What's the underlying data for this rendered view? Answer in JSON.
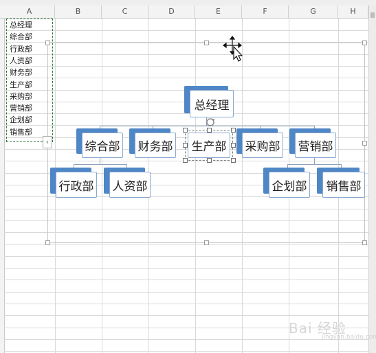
{
  "columns": [
    "A",
    "B",
    "C",
    "D",
    "E",
    "F",
    "G",
    "H"
  ],
  "column_a_cells": [
    "总经理",
    "综合部",
    "行政部",
    "人资部",
    "财务部",
    "生产部",
    "采购部",
    "营销部",
    "企划部",
    "销售部"
  ],
  "org_chart": {
    "root": "总经理",
    "level2": [
      "综合部",
      "财务部",
      "生产部",
      "采购部",
      "营销部"
    ],
    "level3_under_综合部": [
      "行政部",
      "人资部"
    ],
    "level3_under_营销部": [
      "企划部",
      "销售部"
    ],
    "selected_node": "生产部",
    "box_shadow_color": "#4f86c6",
    "connector_color": "#8fa3bd"
  },
  "collapse_button_glyph": "‹",
  "watermark": {
    "text": "Bai 经验",
    "sub": "jingyan.baidu.com"
  },
  "colors": {
    "marquee": "#2e7a3a",
    "gridline": "#d9d9d9",
    "header_bg": "#f3f3f3"
  }
}
